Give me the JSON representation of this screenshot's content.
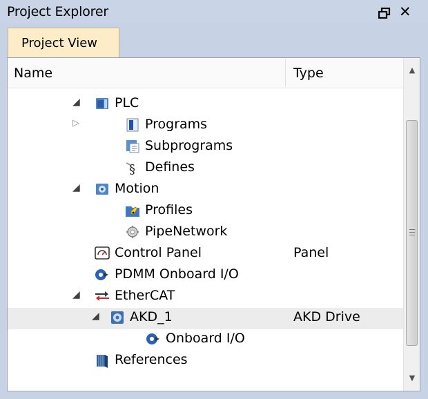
{
  "window": {
    "title": "Project Explorer",
    "pin_icon": "pin-icon",
    "close_glyph": "✕"
  },
  "tab": {
    "label": "Project View"
  },
  "columns": {
    "name": "Name",
    "type": "Type"
  },
  "tree": [
    {
      "label": "PLC",
      "type": "",
      "icon": "plc-icon",
      "expander": "open",
      "depth": 0
    },
    {
      "label": "Programs",
      "type": "",
      "icon": "programs-icon",
      "expander": "closed",
      "depth": 1
    },
    {
      "label": "Subprograms",
      "type": "",
      "icon": "subprograms-icon",
      "expander": "none",
      "depth": 1
    },
    {
      "label": "Defines",
      "type": "",
      "icon": "defines-icon",
      "expander": "none",
      "depth": 1
    },
    {
      "label": "Motion",
      "type": "",
      "icon": "motion-icon",
      "expander": "open",
      "depth": 0
    },
    {
      "label": "Profiles",
      "type": "",
      "icon": "profiles-icon",
      "expander": "none",
      "depth": 1
    },
    {
      "label": "PipeNetwork",
      "type": "",
      "icon": "pipenetwork-icon",
      "expander": "none",
      "depth": 1
    },
    {
      "label": "Control Panel",
      "type": "Panel",
      "icon": "control-panel-icon",
      "expander": "none",
      "depth": 0
    },
    {
      "label": "PDMM Onboard I/O",
      "type": "",
      "icon": "io-icon",
      "expander": "none",
      "depth": 0
    },
    {
      "label": "EtherCAT",
      "type": "",
      "icon": "ethercat-icon",
      "expander": "open",
      "depth": 0
    },
    {
      "label": "AKD_1",
      "type": "AKD Drive",
      "icon": "drive-icon",
      "expander": "open",
      "depth": 1,
      "selected": true
    },
    {
      "label": "Onboard I/O",
      "type": "",
      "icon": "io-icon",
      "expander": "none",
      "depth": 2
    },
    {
      "label": "References",
      "type": "",
      "icon": "references-icon",
      "expander": "none",
      "depth": 0
    }
  ],
  "scrollbar": {
    "up_glyph": "▲",
    "down_glyph": "▼",
    "position_fraction": 0.3
  }
}
